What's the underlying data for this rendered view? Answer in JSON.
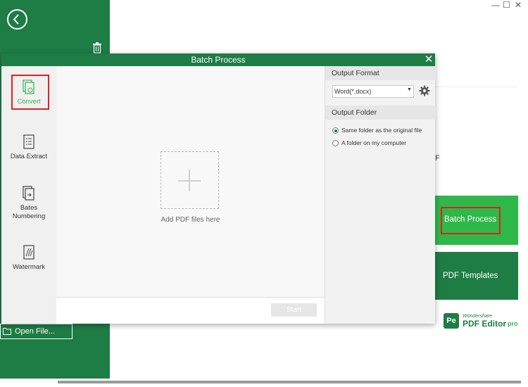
{
  "app": {
    "window_controls": [
      "—",
      "☐",
      "✕"
    ],
    "open_file_label": "Open File...",
    "pdf_partial": "F",
    "batch_card_label": "Batch Process",
    "templates_label": "PDF Templates",
    "brand": {
      "logo": "Pe",
      "small": "Wondershare",
      "name": "PDF Editor",
      "suffix": "pro"
    }
  },
  "dialog": {
    "title": "Batch Process",
    "close": "✕",
    "tools": [
      {
        "label": "Convert",
        "icon": "convert-icon",
        "active": true
      },
      {
        "label": "Data Extract",
        "icon": "data-extract-icon"
      },
      {
        "label": "Bates\nNumbering",
        "icon": "bates-numbering-icon"
      },
      {
        "label": "Watermark",
        "icon": "watermark-icon"
      }
    ],
    "drop_text": "Add PDF files here",
    "start_label": "Start",
    "output_format": {
      "heading": "Output Format",
      "selected": "Word(*.docx)"
    },
    "output_folder": {
      "heading": "Output Folder",
      "options": [
        "Same folder as the original file",
        "A folder on my computer"
      ],
      "selected_index": 0
    }
  },
  "colors": {
    "brand_green": "#1e7c45",
    "accent_green": "#2fb84a",
    "highlight_red": "#e02020"
  }
}
